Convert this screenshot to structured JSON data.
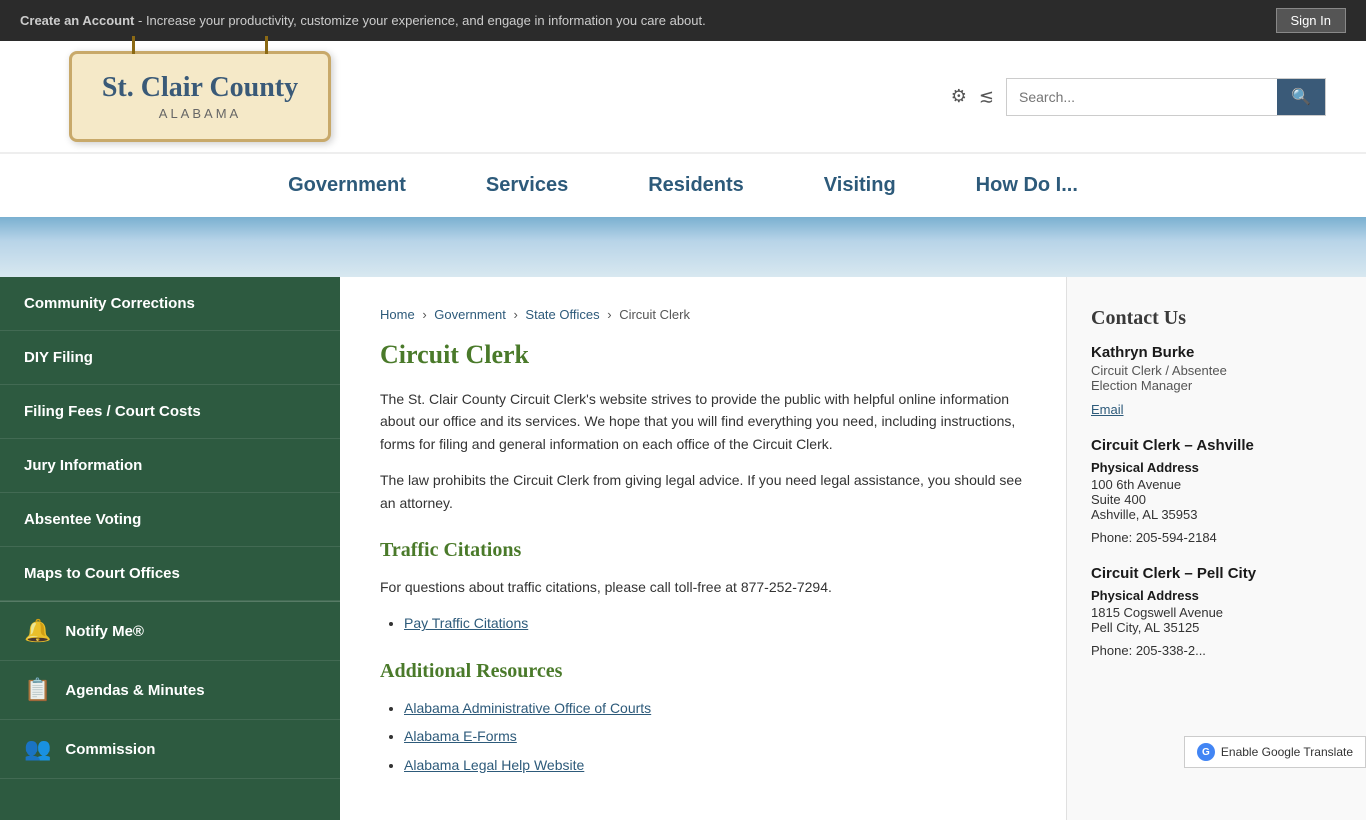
{
  "top_banner": {
    "text_prefix": "Create an Account",
    "text_main": " - Increase your productivity, customize your experience, and engage in information you care about.",
    "sign_in_label": "Sign In"
  },
  "header": {
    "logo_title": "St. Clair County",
    "logo_subtitle": "ALABAMA",
    "search_placeholder": "Search..."
  },
  "nav": {
    "items": [
      {
        "label": "Government"
      },
      {
        "label": "Services"
      },
      {
        "label": "Residents"
      },
      {
        "label": "Visiting"
      },
      {
        "label": "How Do I..."
      }
    ]
  },
  "sidebar": {
    "links": [
      {
        "label": "Community Corrections"
      },
      {
        "label": "DIY Filing"
      },
      {
        "label": "Filing Fees / Court Costs"
      },
      {
        "label": "Jury Information"
      },
      {
        "label": "Absentee Voting"
      },
      {
        "label": "Maps to Court Offices"
      }
    ],
    "icon_links": [
      {
        "label": "Notify Me®",
        "icon": "🔔"
      },
      {
        "label": "Agendas & Minutes",
        "icon": "📋"
      },
      {
        "label": "Commission",
        "icon": "👥"
      }
    ]
  },
  "breadcrumb": {
    "items": [
      {
        "label": "Home",
        "href": "#"
      },
      {
        "label": "Government",
        "href": "#"
      },
      {
        "label": "State Offices",
        "href": "#"
      },
      {
        "label": "Circuit Clerk",
        "href": "#"
      }
    ]
  },
  "main": {
    "page_title": "Circuit Clerk",
    "intro_p1": "The St. Clair County Circuit Clerk's website strives to provide the public with helpful online information about our office and its services. We hope that you will find everything you need, including instructions, forms for filing and general information on each office of the Circuit Clerk.",
    "intro_p2": "The law prohibits the Circuit Clerk from giving legal advice. If you need legal assistance, you should see an attorney.",
    "traffic_section_title": "Traffic Citations",
    "traffic_p1": "For questions about traffic citations, please call toll-free at 877-252-7294.",
    "traffic_link": "Pay Traffic Citations",
    "additional_section_title": "Additional Resources",
    "additional_links": [
      {
        "label": "Alabama Administrative Office of Courts"
      },
      {
        "label": "Alabama E-Forms"
      },
      {
        "label": "Alabama Legal Help Website"
      }
    ]
  },
  "contact": {
    "section_title": "Contact Us",
    "name": "Kathryn Burke",
    "title_line1": "Circuit Clerk / Absentee",
    "title_line2": "Election Manager",
    "email_label": "Email",
    "offices": [
      {
        "name": "Circuit Clerk – Ashville",
        "address_label": "Physical Address",
        "address": [
          "100 6th Avenue",
          "Suite 400",
          "Ashville, AL 35953"
        ],
        "phone": "Phone: 205-594-2184"
      },
      {
        "name": "Circuit Clerk – Pell City",
        "address_label": "Physical Address",
        "address": [
          "1815 Cogswell Avenue",
          "Pell City, AL 35125"
        ],
        "phone": "Phone: 205-338-2..."
      }
    ]
  },
  "footer": {
    "translate_label": "Enable Google Translate"
  }
}
